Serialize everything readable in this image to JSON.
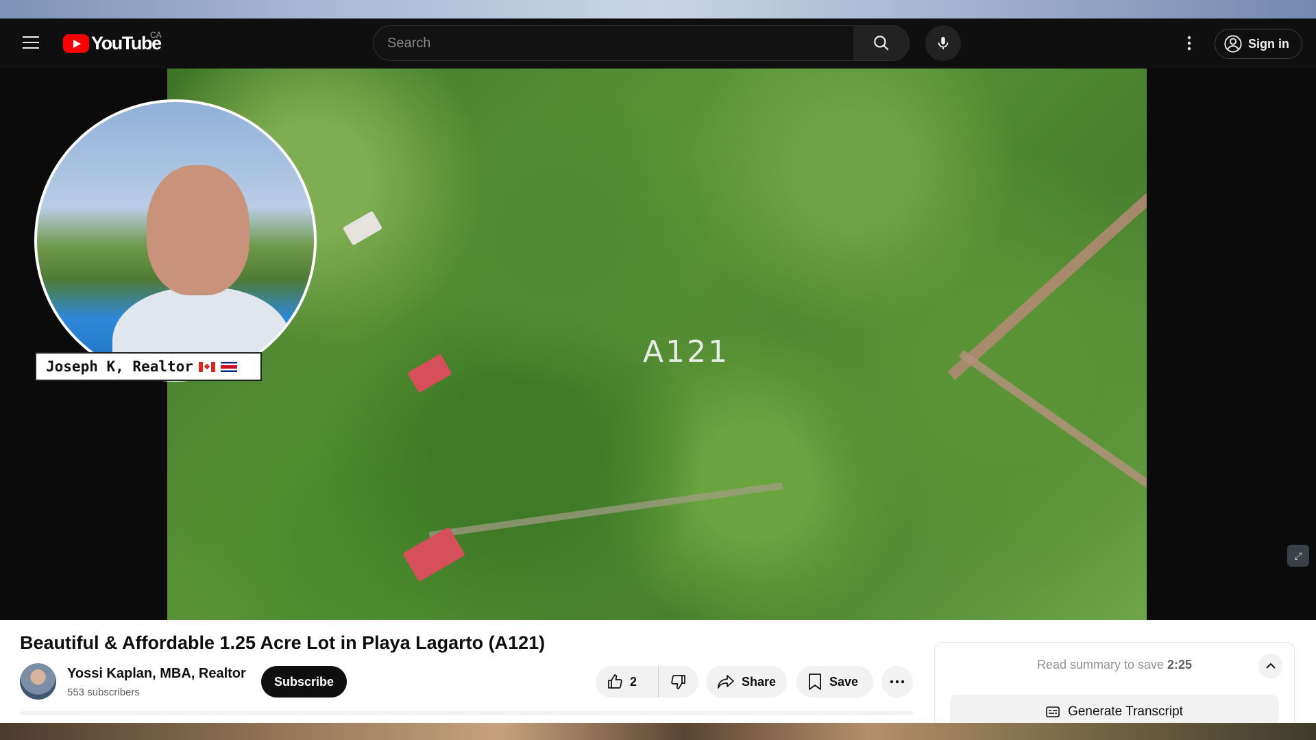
{
  "masthead": {
    "logo_text": "YouTube",
    "region": "CA",
    "search_placeholder": "Search",
    "sign_in_label": "Sign in"
  },
  "video": {
    "overlay_label": "A121",
    "presenter_tag": "Joseph K, Realtor",
    "flags": [
      "canada-flag",
      "costa-rica-flag"
    ]
  },
  "details": {
    "title": "Beautiful & Affordable 1.25 Acre Lot in Playa Lagarto (A121)",
    "channel_name": "Yossi Kaplan, MBA, Realtor",
    "subscribers": "553 subscribers",
    "subscribe_label": "Subscribe",
    "like_count": "2",
    "share_label": "Share",
    "save_label": "Save"
  },
  "summary": {
    "prefix": "Read summary to save",
    "time_saved": "2:25",
    "generate_label": "Generate Transcript"
  },
  "colors": {
    "brand_red": "#ff0000",
    "masthead_bg": "#0f0f0f",
    "accent_blue": "#2f8fe6"
  },
  "icons": [
    "menu-icon",
    "search-icon",
    "mic-icon",
    "more-vert-icon",
    "account-icon",
    "like-icon",
    "dislike-icon",
    "share-icon",
    "bookmark-icon",
    "more-horiz-icon",
    "chevron-up-icon",
    "transcript-icon",
    "miniplayer-icon"
  ]
}
